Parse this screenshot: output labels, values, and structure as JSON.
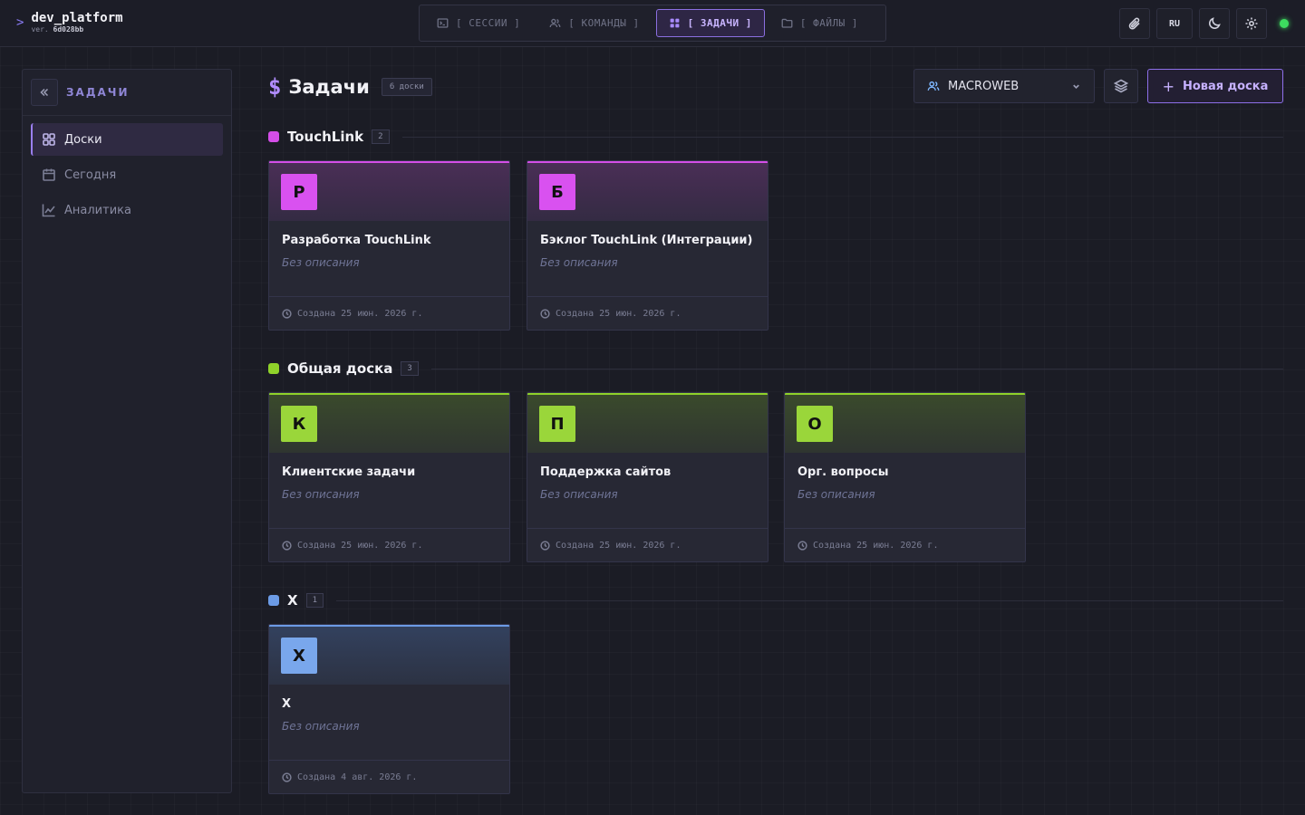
{
  "app": {
    "prompt": ">",
    "name": "dev_platform",
    "version_label": "ver.",
    "version": "6d028bb"
  },
  "nav": {
    "tabs": [
      {
        "label": "[ СЕССИИ ]",
        "icon": "terminal-icon"
      },
      {
        "label": "[ КОМАНДЫ ]",
        "icon": "users-icon"
      },
      {
        "label": "[ ЗАДАЧИ ]",
        "icon": "grid-icon",
        "active": true
      },
      {
        "label": "[ ФАЙЛЫ ]",
        "icon": "folder-icon"
      }
    ]
  },
  "topright": {
    "lang": "RU"
  },
  "sidebar": {
    "title": "ЗАДАЧИ",
    "items": [
      {
        "label": "Доски",
        "icon": "grid-icon",
        "active": true
      },
      {
        "label": "Сегодня",
        "icon": "calendar-icon"
      },
      {
        "label": "Аналитика",
        "icon": "chart-line-icon"
      }
    ]
  },
  "header": {
    "symbol": "$",
    "title": "Задачи",
    "boards_count": "6 доски",
    "team": "MACROWEB",
    "new_board": "Новая доска",
    "new_board_plus": "+"
  },
  "colors": {
    "accent": "#8b6fe0",
    "pink": "#d951f0",
    "green": "#9ad63a",
    "blue": "#79a7ec",
    "status": "#3ddc5f"
  },
  "groups": [
    {
      "name": "TouchLink",
      "count": "2",
      "color": "#d44ee8",
      "boards": [
        {
          "letter": "Р",
          "title": "Разработка TouchLink",
          "desc": "Без описания",
          "created": "Создана 25 июн. 2026 г."
        },
        {
          "letter": "Б",
          "title": "Бэклог TouchLink (Интеграции)",
          "desc": "Без описания",
          "created": "Создана 25 июн. 2026 г."
        }
      ]
    },
    {
      "name": "Общая доска",
      "count": "3",
      "color": "#8fd22a",
      "boards": [
        {
          "letter": "К",
          "title": "Клиентские задачи",
          "desc": "Без описания",
          "created": "Создана 25 июн. 2026 г."
        },
        {
          "letter": "П",
          "title": "Поддержка сайтов",
          "desc": "Без описания",
          "created": "Создана 25 июн. 2026 г."
        },
        {
          "letter": "О",
          "title": "Орг. вопросы",
          "desc": "Без описания",
          "created": "Создана 25 июн. 2026 г."
        }
      ]
    },
    {
      "name": "X",
      "count": "1",
      "color": "#6c9be6",
      "boards": [
        {
          "letter": "X",
          "title": "X",
          "desc": "Без описания",
          "created": "Создана 4 авг. 2026 г."
        }
      ]
    }
  ]
}
